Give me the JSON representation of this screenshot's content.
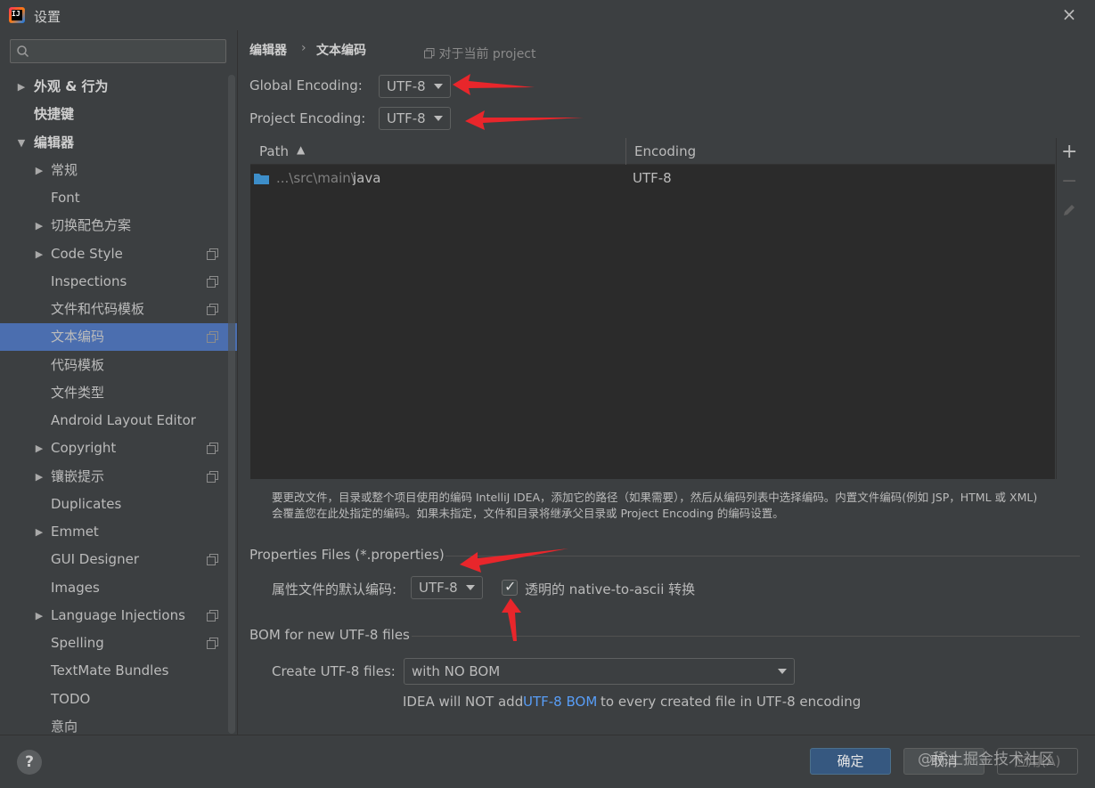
{
  "window": {
    "title": "设置",
    "close_icon": "×"
  },
  "sidebar": {
    "search": {
      "value": "",
      "placeholder": ""
    },
    "items": [
      {
        "label": "外观 & 行为",
        "expandable": true,
        "expanded": false,
        "indent": 0,
        "bold": true,
        "copy_icon": false
      },
      {
        "label": "快捷键",
        "expandable": false,
        "indent": 0,
        "bold": true,
        "copy_icon": false
      },
      {
        "label": "编辑器",
        "expandable": true,
        "expanded": true,
        "indent": 0,
        "bold": true,
        "copy_icon": false
      },
      {
        "label": "常规",
        "expandable": true,
        "expanded": false,
        "indent": 1,
        "copy_icon": false
      },
      {
        "label": "Font",
        "expandable": false,
        "indent": 1,
        "copy_icon": false
      },
      {
        "label": "切换配色方案",
        "expandable": true,
        "expanded": false,
        "indent": 1,
        "copy_icon": false
      },
      {
        "label": "Code Style",
        "expandable": true,
        "expanded": false,
        "indent": 1,
        "copy_icon": true
      },
      {
        "label": "Inspections",
        "expandable": false,
        "indent": 1,
        "copy_icon": true
      },
      {
        "label": "文件和代码模板",
        "expandable": false,
        "indent": 1,
        "copy_icon": true
      },
      {
        "label": "文本编码",
        "expandable": false,
        "indent": 1,
        "copy_icon": true,
        "selected": true
      },
      {
        "label": "代码模板",
        "expandable": false,
        "indent": 1,
        "copy_icon": false
      },
      {
        "label": "文件类型",
        "expandable": false,
        "indent": 1,
        "copy_icon": false
      },
      {
        "label": "Android Layout Editor",
        "expandable": false,
        "indent": 1,
        "copy_icon": false
      },
      {
        "label": "Copyright",
        "expandable": true,
        "expanded": false,
        "indent": 1,
        "copy_icon": true
      },
      {
        "label": "镶嵌提示",
        "expandable": true,
        "expanded": false,
        "indent": 1,
        "copy_icon": true
      },
      {
        "label": "Duplicates",
        "expandable": false,
        "indent": 1,
        "copy_icon": false
      },
      {
        "label": "Emmet",
        "expandable": true,
        "expanded": false,
        "indent": 1,
        "copy_icon": false
      },
      {
        "label": "GUI Designer",
        "expandable": false,
        "indent": 1,
        "copy_icon": true
      },
      {
        "label": "Images",
        "expandable": false,
        "indent": 1,
        "copy_icon": false
      },
      {
        "label": "Language Injections",
        "expandable": true,
        "expanded": false,
        "indent": 1,
        "copy_icon": true
      },
      {
        "label": "Spelling",
        "expandable": false,
        "indent": 1,
        "copy_icon": true
      },
      {
        "label": "TextMate Bundles",
        "expandable": false,
        "indent": 1,
        "copy_icon": false
      },
      {
        "label": "TODO",
        "expandable": false,
        "indent": 1,
        "copy_icon": false
      },
      {
        "label": "意向",
        "expandable": false,
        "indent": 1,
        "copy_icon": false
      }
    ]
  },
  "breadcrumb": {
    "parent": "编辑器",
    "separator": "›",
    "current": "文本编码",
    "scope": "对于当前 project"
  },
  "encoding": {
    "global_label": "Global Encoding:",
    "global_value": "UTF-8",
    "project_label": "Project Encoding:",
    "project_value": "UTF-8"
  },
  "table": {
    "columns": [
      "Path",
      "Encoding"
    ],
    "rows": [
      {
        "path_prefix": "...\\src\\main\\",
        "path_file": "java",
        "encoding": "UTF-8"
      }
    ],
    "toolbar": {
      "add": "+",
      "remove": "−"
    }
  },
  "help_text": {
    "line1": "要更改文件，目录或整个项目使用的编码 IntelliJ IDEA，添加它的路径（如果需要），然后从编码列表中选择编码。内置文件编码(例如 JSP，HTML 或 XML)",
    "line2": "会覆盖您在此处指定的编码。如果未指定，文件和目录将继承父目录或 Project Encoding 的编码设置。"
  },
  "properties": {
    "section_title": "Properties Files (*.properties)",
    "default_label": "属性文件的默认编码:",
    "default_value": "UTF-8",
    "native_to_ascii_label": "透明的 native-to-ascii 转换",
    "native_to_ascii_checked": true
  },
  "bom": {
    "section_title": "BOM for new UTF-8 files",
    "create_label": "Create UTF-8 files:",
    "create_value": "with NO BOM",
    "note_pre": "IDEA will NOT add",
    "note_link": "UTF-8 BOM",
    "note_post": "to every created file in UTF-8 encoding"
  },
  "footer": {
    "help": "?",
    "ok": "确定",
    "cancel": "取消",
    "apply": "应用(A)",
    "watermark": "@稀土掘金技术社区"
  },
  "colors": {
    "background": "#3c3f41",
    "table_background": "#2b2b2b",
    "selection": "#4b6eaf",
    "primary_button": "#365880",
    "link": "#589df6",
    "annotation_arrow": "#e8262b",
    "folder_icon": "#3d8ec9"
  }
}
